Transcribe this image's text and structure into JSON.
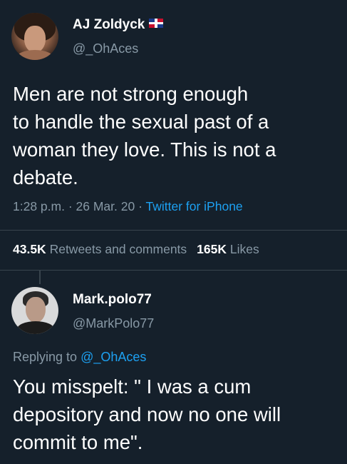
{
  "main_tweet": {
    "display_name": "AJ Zoldyck",
    "handle": "@_OhAces",
    "flag_icon": "flag-icon",
    "text": "Men are not strong enough\nto handle the sexual past of a\nwoman they love. This is not a\ndebate.",
    "time": "1:28 p.m.",
    "date": "26 Mar. 20",
    "source": "Twitter for iPhone",
    "separator": " · ",
    "retweets_count": "43.5K",
    "retweets_label": "Retweets and comments",
    "likes_count": "165K",
    "likes_label": "Likes"
  },
  "reply": {
    "display_name": "Mark.polo77",
    "handle": "@MarkPolo77",
    "replying_label": "Replying to",
    "replying_to": "@_OhAces",
    "text": "You misspelt: \" I was a cum\ndepository and now no one will\ncommit to me\"."
  },
  "colors": {
    "background": "#15202b",
    "secondary_text": "#8899a6",
    "link": "#1da1f2",
    "divider": "#38444d"
  }
}
